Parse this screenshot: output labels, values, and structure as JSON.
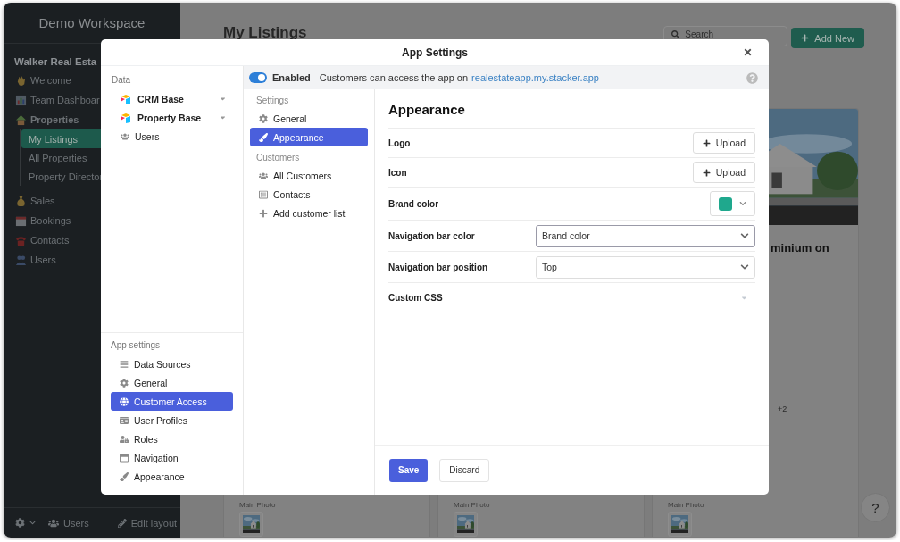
{
  "workspace": {
    "title": "Demo Workspace"
  },
  "sidebar": {
    "app_name": "Walker Real Esta",
    "items": [
      {
        "label": "Welcome",
        "selected": false
      },
      {
        "label": "Team Dashboar",
        "selected": false
      },
      {
        "label": "Properties",
        "selected": false,
        "children": [
          {
            "label": "My Listings",
            "selected": true
          },
          {
            "label": "All Properties",
            "selected": false
          },
          {
            "label": "Property Director",
            "selected": false
          }
        ]
      },
      {
        "label": "Sales",
        "selected": false
      },
      {
        "label": "Bookings",
        "selected": false
      },
      {
        "label": "Contacts",
        "selected": false
      },
      {
        "label": "Users",
        "selected": false
      }
    ],
    "footer": {
      "users": "Users",
      "edit": "Edit layout"
    }
  },
  "page": {
    "title": "My Listings",
    "search": {
      "placeholder": "Search"
    },
    "add_button": "Add New",
    "cards": [
      {
        "field": "Main Photo"
      },
      {
        "field": "Main Photo"
      },
      {
        "field": "Main Photo",
        "photo": true,
        "title": "minium on",
        "more": "+2"
      }
    ]
  },
  "help_button": "?",
  "modal": {
    "title": "App Settings",
    "data": {
      "heading": "Data",
      "items": [
        {
          "label": "CRM Base",
          "kind": "base",
          "expandable": true
        },
        {
          "label": "Property Base",
          "kind": "base",
          "expandable": true
        },
        {
          "label": "Users",
          "kind": "users",
          "expandable": false
        }
      ]
    },
    "app_settings": {
      "heading": "App settings",
      "items": [
        {
          "label": "Data Sources",
          "selected": false
        },
        {
          "label": "General",
          "selected": false
        },
        {
          "label": "Customer Access",
          "selected": true
        },
        {
          "label": "User Profiles",
          "selected": false
        },
        {
          "label": "Roles",
          "selected": false
        },
        {
          "label": "Navigation",
          "selected": false
        },
        {
          "label": "Appearance",
          "selected": false
        }
      ]
    },
    "access": {
      "on": true,
      "label": "Enabled",
      "text": "Customers can access the app on",
      "link": "realestateapp.my.stacker.app"
    },
    "nav": [
      {
        "heading": "Settings",
        "items": [
          {
            "label": "General",
            "selected": false
          },
          {
            "label": "Appearance",
            "selected": true
          }
        ]
      },
      {
        "heading": "Customers",
        "items": [
          {
            "label": "All Customers",
            "selected": false
          },
          {
            "label": "Contacts",
            "selected": false
          },
          {
            "label": "Add customer list",
            "selected": false
          }
        ]
      }
    ],
    "content": {
      "title": "Appearance",
      "rows": [
        {
          "label": "Logo",
          "kind": "upload",
          "button": "Upload"
        },
        {
          "label": "Icon",
          "kind": "upload",
          "button": "Upload"
        },
        {
          "label": "Brand color",
          "kind": "color",
          "color": "#1fa88d"
        },
        {
          "label": "Navigation bar color",
          "kind": "select",
          "value": "Brand color",
          "focused": true
        },
        {
          "label": "Navigation bar position",
          "kind": "select",
          "value": "Top",
          "focused": false
        },
        {
          "label": "Custom CSS",
          "kind": "collapsible",
          "expanded": false
        }
      ]
    },
    "footer": {
      "save": "Save",
      "discard": "Discard"
    }
  }
}
